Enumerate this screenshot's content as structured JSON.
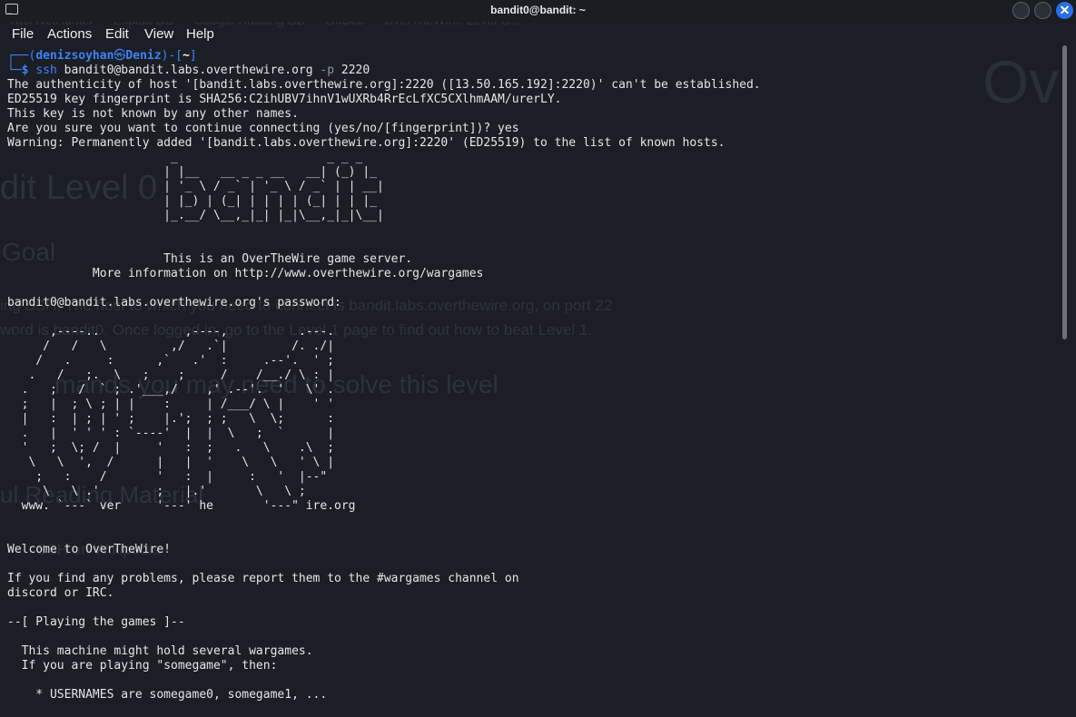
{
  "window": {
    "title": "bandit0@bandit: ~",
    "icon": "terminal-icon",
    "controls": [
      "minimize-icon",
      "maximize-icon",
      "close-icon"
    ],
    "close_glyph": "✕"
  },
  "menu": [
    "File",
    "Actions",
    "Edit",
    "View",
    "Help"
  ],
  "ghost": {
    "bookmarks": [
      "Kali NetHunter",
      "Exploit-DB",
      "Google Hacking DB",
      "OffSec",
      "OverTheWire: Level G..."
    ],
    "heading": "dit Level 0",
    "goal": "Goal",
    "body1": "ing SSH. The host to which you need to connect is bandit.labs.overthewire.org, on port 22",
    "body2": "word is bandit0. Once logged in, go to the Level 1 page to find out how to beat Level 1.",
    "commands": "mands you may need to solve this level",
    "reading": "ul Reading Material",
    "link": "SSH on Wikipedia",
    "logo": "Ov"
  },
  "prompt": {
    "top_prefix": "┌──(",
    "user": "denizsoyhan",
    "at": "㉿",
    "host": "Deniz",
    "mid": ")-[",
    "dir": "~",
    "end": "]",
    "bottom_prefix": "└─",
    "dollar": "$ ",
    "cmd": "ssh",
    "args": " bandit0@bandit.labs.overthewire.org ",
    "flag": "-p",
    "port": " 2220"
  },
  "output": [
    "The authenticity of host '[bandit.labs.overthewire.org]:2220 ([13.50.165.192]:2220)' can't be established.",
    "ED25519 key fingerprint is SHA256:C2ihUBV7ihnV1wUXRb4RrEcLfXC5CXlhmAAM/urerLY.",
    "This key is not known by any other names.",
    "Are you sure you want to continue connecting (yes/no/[fingerprint])? yes",
    "Warning: Permanently added '[bandit.labs.overthewire.org]:2220' (ED25519) to the list of known hosts.",
    "                       _                     _ _ _",
    "                      | |__   __ _ _ __   __| (_) |_",
    "                      | '_ \\ / _` | '_ \\ / _` | | __|",
    "                      | |_) | (_| | | | | (_| | | |_",
    "                      |_.__/ \\__,_|_| |_|\\__,_|_|\\__|",
    "",
    "",
    "                      This is an OverTheWire game server.",
    "            More information on http://www.overthewire.org/wargames",
    "",
    "bandit0@bandit.labs.overthewire.org's password:",
    "",
    "      ,----..            ,----,          .---.",
    "     /   /   \\         ,/   .`|         /. ./|",
    "    /   .     :      ,`   .'  :     .--'.  ' ;",
    "   .   /   ;.  \\   ;    ;     /    /__./ \\ : |",
    "  .   ;   /  ` ; .'___,/    ,' .--'.  '   \\' .",
    "  ;   |  ; \\ ; | |    :     | /___/ \\ |    ' '",
    "  |   :  | ; | ' ;    |.';  ; ;   \\  \\;      :",
    "  .   |  ' ' ' : `----'  |  |  \\   ;  `      |",
    "  '   ;  \\; /  |     '   :  ;   .   \\    .\\  ;",
    "   \\   \\  ',  /      |   |  '    \\   \\   ' \\ |",
    "    ;   :    /       '   :  |     :   '  |--\"",
    "     \\   \\ .'        ;   |.'       \\   \\ ;",
    "  www. `---` ver     '---' he       '---\" ire.org",
    "",
    "",
    "Welcome to OverTheWire!",
    "",
    "If you find any problems, please report them to the #wargames channel on",
    "discord or IRC.",
    "",
    "--[ Playing the games ]--",
    "",
    "  This machine might hold several wargames.",
    "  If you are playing \"somegame\", then:",
    "",
    "    * USERNAMES are somegame0, somegame1, ..."
  ]
}
